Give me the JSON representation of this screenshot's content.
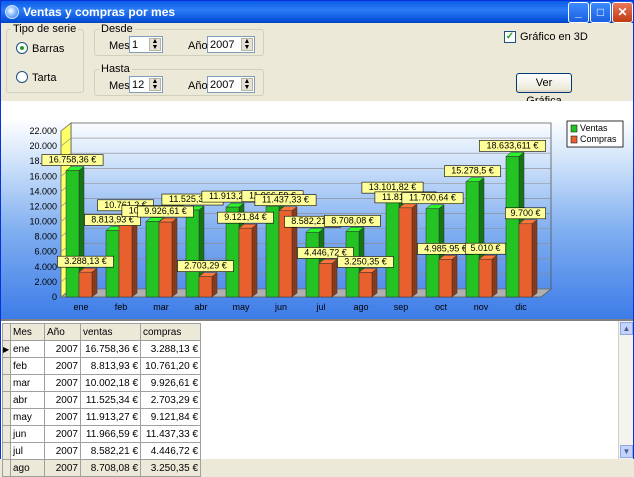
{
  "window": {
    "title": "Ventas y compras por mes",
    "controls": {
      "minimize": "_",
      "maximize": "□",
      "close": "✕"
    }
  },
  "tipo_serie": {
    "label": "Tipo de serie",
    "options": [
      {
        "label": "Barras",
        "selected": true
      },
      {
        "label": "Tarta",
        "selected": false
      }
    ]
  },
  "desde": {
    "label": "Desde",
    "mes_label": "Mes",
    "mes": "1",
    "anio_label": "Año",
    "anio": "2007"
  },
  "hasta": {
    "label": "Hasta",
    "mes_label": "Mes",
    "mes": "12",
    "anio_label": "Año",
    "anio": "2007"
  },
  "grafico3d": {
    "label": "Gráfico en 3D",
    "checked": true
  },
  "ver_grafica": "Ver Gráfica",
  "chart_data": {
    "type": "bar",
    "categories": [
      "ene",
      "feb",
      "mar",
      "abr",
      "may",
      "jun",
      "jul",
      "ago",
      "sep",
      "oct",
      "nov",
      "dic"
    ],
    "series": [
      {
        "name": "Ventas",
        "color": "#22c322",
        "values": [
          16758.36,
          8813.93,
          10002.18,
          11525.34,
          11913.27,
          11966.59,
          8582.21,
          8708.08,
          13101.82,
          11700,
          15278.5,
          18633.611
        ],
        "labels": [
          "16.758,36 €",
          "8.813,93 €",
          "10.002,18 €",
          "11.525,34 €",
          "11.913,27 €",
          "11.966,59 €",
          "8.582,21 €",
          "8.708,08 €",
          "13.101,82 €",
          "11.700,64 €",
          "15.278,5 €",
          "18.633,611 €"
        ]
      },
      {
        "name": "Compras",
        "color": "#e8602e",
        "values": [
          3288.13,
          10761.2,
          9926.61,
          2703.29,
          9121.84,
          11437.33,
          4446.72,
          3250.35,
          11813.58,
          4985.95,
          5010,
          9700
        ],
        "labels": [
          "3.288,13 €",
          "10.761,2 €",
          "9.926,61 €",
          "2.703,29 €",
          "9.121,84 €",
          "11.437,33 €",
          "4.446,72 €",
          "3.250,35 €",
          "11.813,58 €",
          "4.985,95 €",
          "5.010 €",
          "9.700 €"
        ]
      }
    ],
    "yticks": [
      "0",
      "2.000",
      "4.000",
      "6.000",
      "8.000",
      "10.000",
      "12.000",
      "14.000",
      "16.000",
      "18.000",
      "20.000",
      "22.000"
    ],
    "ylim": [
      0,
      22000
    ],
    "legend_position": "top-right",
    "three_d": true
  },
  "table": {
    "columns": [
      "Mes",
      "Año",
      "ventas",
      "compras"
    ],
    "rows": [
      [
        "ene",
        "2007",
        "16.758,36 €",
        "3.288,13 €"
      ],
      [
        "feb",
        "2007",
        "8.813,93 €",
        "10.761,20 €"
      ],
      [
        "mar",
        "2007",
        "10.002,18 €",
        "9.926,61 €"
      ],
      [
        "abr",
        "2007",
        "11.525,34 €",
        "2.703,29 €"
      ],
      [
        "may",
        "2007",
        "11.913,27 €",
        "9.121,84 €"
      ],
      [
        "jun",
        "2007",
        "11.966,59 €",
        "11.437,33 €"
      ],
      [
        "jul",
        "2007",
        "8.582,21 €",
        "4.446,72 €"
      ],
      [
        "ago",
        "2007",
        "8.708,08 €",
        "3.250,35 €"
      ]
    ],
    "current_row": 0
  }
}
